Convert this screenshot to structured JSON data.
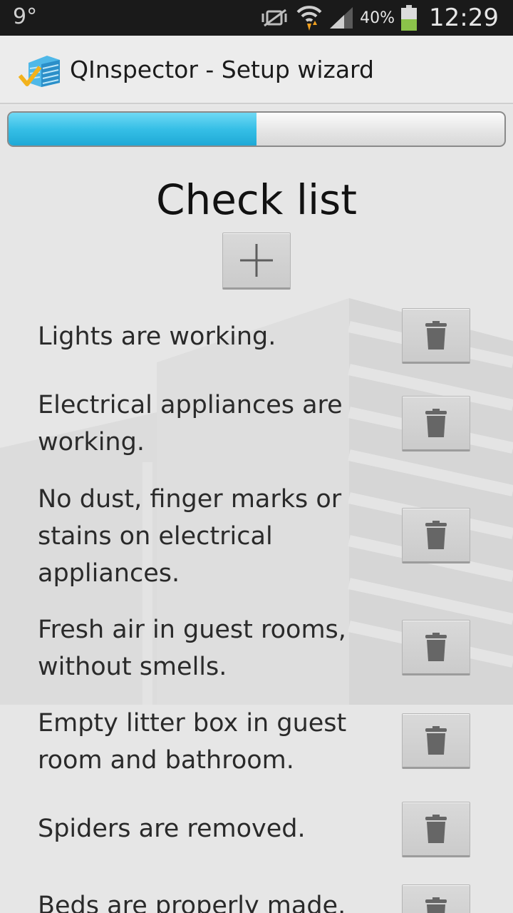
{
  "status_bar": {
    "left_indicator": "9°",
    "battery_percent": "40%",
    "time": "12:29"
  },
  "app": {
    "title": "QInspector - Setup wizard"
  },
  "progress": {
    "fraction": 0.5
  },
  "screen": {
    "heading": "Check list"
  },
  "checklist": {
    "items": [
      "Lights are working.",
      "Electrical appliances are working.",
      "No dust, finger marks or stains on electrical appliances.",
      "Fresh air in guest rooms, without smells.",
      "Empty litter box in guest room and bathroom.",
      "Spiders are removed.",
      "Beds are properly made."
    ]
  },
  "icons": {
    "add": "plus-icon",
    "delete": "trash-icon",
    "logo": "building-check-icon"
  },
  "colors": {
    "accent": "#36bfe6",
    "status_bar_bg": "#1a1a1a",
    "battery_level": "#8bc34a"
  }
}
